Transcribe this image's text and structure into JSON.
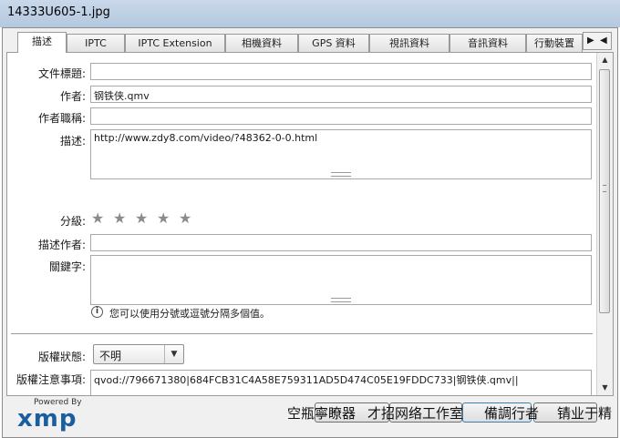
{
  "window": {
    "title": "14333U605-1.jpg"
  },
  "tabs": [
    {
      "label": "描述",
      "active": true
    },
    {
      "label": "IPTC"
    },
    {
      "label": "IPTC Extension"
    },
    {
      "label": "相機資料"
    },
    {
      "label": "GPS 資料"
    },
    {
      "label": "視訊資料"
    },
    {
      "label": "音訊資料"
    },
    {
      "label": "行動裝置"
    }
  ],
  "tab_nav": {
    "left_icon": "triangle-right-icon",
    "right_icon": "triangle-left-icon"
  },
  "form": {
    "doc_title": {
      "label": "文件標題:",
      "value": ""
    },
    "author": {
      "label": "作者:",
      "value": "钢铁侠.qmv"
    },
    "author_title": {
      "label": "作者職稱:",
      "value": ""
    },
    "description": {
      "label": "描述:",
      "value": "http://www.zdy8.com/video/?48362-0-0.html"
    },
    "rating": {
      "label": "分級:",
      "stars": 5,
      "filled": 0
    },
    "description_writer": {
      "label": "描述作者:",
      "value": ""
    },
    "keywords": {
      "label": "關鍵字:",
      "value": ""
    },
    "hint": "您可以使用分號或逗號分隔多個值。",
    "copyright_status": {
      "label": "版權狀態:",
      "value": "不明"
    },
    "copyright_notice": {
      "label": "版權注意事項:",
      "value": "qvod://796671380|684FCB31C4A58E759311AD5D474C05E19FDDC733|钢铁侠.qmv||"
    }
  },
  "footer": {
    "powered_by": "Powered By",
    "logo": "xmp",
    "overlay_text": [
      "空瓶寧瞭器",
      "才招网络工作室",
      "備調行者",
      "锖业于精"
    ]
  }
}
